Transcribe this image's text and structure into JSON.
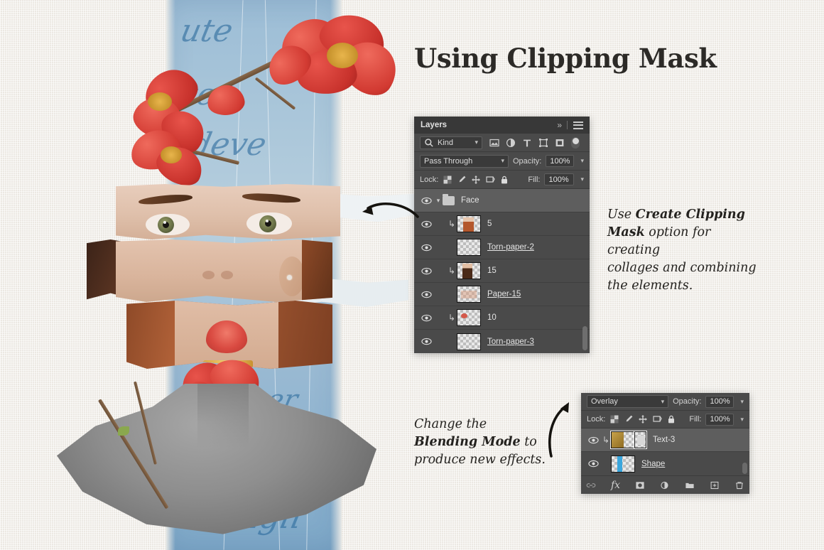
{
  "page": {
    "title": "Using Clipping Mask",
    "background_color": "#f3f0ea"
  },
  "notes": [
    {
      "id": "clipping-note",
      "lines": [
        {
          "plain_before": "Use ",
          "bold": "Create Clipping",
          "plain_after": ""
        },
        {
          "plain_before": "",
          "bold": "Mask",
          "plain_after": " option for creating"
        },
        {
          "plain_before": "collages and combining",
          "bold": "",
          "plain_after": ""
        },
        {
          "plain_before": "the elements.",
          "bold": "",
          "plain_after": ""
        }
      ]
    },
    {
      "id": "blending-note",
      "lines": [
        {
          "plain_before": "Change the",
          "bold": "",
          "plain_after": ""
        },
        {
          "plain_before": "",
          "bold": "Blending Mode",
          "plain_after": " to"
        },
        {
          "plain_before": "produce new effects.",
          "bold": "",
          "plain_after": ""
        }
      ]
    }
  ],
  "layers_panel": {
    "tab_label": "Layers",
    "collapse_icon": "chevron-double-right-icon",
    "menu_icon": "panel-menu-icon",
    "filter": {
      "search_icon": "search-icon",
      "kind_label": "Kind",
      "chevron": "chevron-down-icon",
      "icons": [
        "image-filter-icon",
        "adjustment-filter-icon",
        "type-filter-icon",
        "shape-filter-icon",
        "smartobject-filter-icon"
      ],
      "toggle_icon": "filter-toggle-icon"
    },
    "blend": {
      "mode": "Pass Through",
      "opacity_label": "Opacity:",
      "opacity_value": "100%"
    },
    "lock": {
      "label": "Lock:",
      "icons": [
        "lock-transparency-icon",
        "lock-image-icon",
        "lock-position-icon",
        "lock-artboard-icon",
        "lock-all-icon"
      ],
      "fill_label": "Fill:",
      "fill_value": "100%"
    },
    "rows": [
      {
        "name": "Face",
        "type": "group",
        "visible": true,
        "selected": true,
        "clipped": false,
        "underline": false,
        "thumb": "folder"
      },
      {
        "name": "5",
        "type": "layer",
        "visible": true,
        "selected": false,
        "clipped": true,
        "underline": false,
        "thumb": "portrait"
      },
      {
        "name": "Torn-paper-2",
        "type": "layer",
        "visible": true,
        "selected": false,
        "clipped": false,
        "underline": true,
        "thumb": "empty"
      },
      {
        "name": "15",
        "type": "layer",
        "visible": true,
        "selected": false,
        "clipped": true,
        "underline": false,
        "thumb": "portrait-dark"
      },
      {
        "name": "Paper-15",
        "type": "layer",
        "visible": true,
        "selected": false,
        "clipped": false,
        "underline": true,
        "thumb": "paper"
      },
      {
        "name": "10",
        "type": "layer",
        "visible": true,
        "selected": false,
        "clipped": true,
        "underline": false,
        "thumb": "flower"
      },
      {
        "name": "Torn-paper-3",
        "type": "layer",
        "visible": true,
        "selected": false,
        "clipped": false,
        "underline": true,
        "thumb": "empty"
      }
    ]
  },
  "blend_panel": {
    "blend": {
      "mode": "Overlay",
      "opacity_label": "Opacity:",
      "opacity_value": "100%"
    },
    "lock": {
      "label": "Lock:",
      "icons": [
        "lock-transparency-icon",
        "lock-image-icon",
        "lock-position-icon",
        "lock-artboard-icon",
        "lock-all-icon"
      ],
      "fill_label": "Fill:",
      "fill_value": "100%"
    },
    "rows": [
      {
        "name": "Text-3",
        "visible": true,
        "selected": true,
        "clipped": true,
        "underline": false,
        "thumb": "gold-text"
      },
      {
        "name": "Shape",
        "visible": true,
        "selected": false,
        "clipped": false,
        "underline": true,
        "thumb": "blue-stripe"
      }
    ],
    "bottom_icons": [
      "link-layers-icon",
      "layer-style-fx-icon",
      "add-mask-icon",
      "adjustment-layer-icon",
      "new-group-icon",
      "new-layer-icon",
      "delete-layer-icon"
    ]
  },
  "arrows": [
    {
      "id": "arrow-to-layers-panel",
      "direction": "left"
    },
    {
      "id": "arrow-to-blend-panel",
      "direction": "up"
    }
  ],
  "artwork": {
    "description": "torn-paper collage portrait",
    "elements": [
      "red-quince-flowers",
      "thorny-branch",
      "blue-script-paper",
      "fragmented-face",
      "grey-statue-bust"
    ],
    "script_words": [
      "ute",
      "te",
      "edeve",
      "ver",
      "vagli"
    ]
  }
}
